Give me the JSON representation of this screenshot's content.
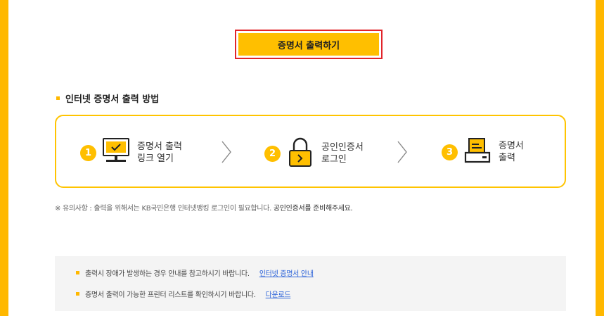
{
  "print_button": {
    "label": "증명서 출력하기"
  },
  "section": {
    "title": "인터넷 증명서 출력 방법"
  },
  "steps": [
    {
      "num": "1",
      "line1": "증명서 출력",
      "line2": "링크 열기",
      "icon": "monitor-check-icon"
    },
    {
      "num": "2",
      "line1": "공인인증서",
      "line2": "로그인",
      "icon": "padlock-icon"
    },
    {
      "num": "3",
      "line1": "증명서",
      "line2": "출력",
      "icon": "printer-icon"
    }
  ],
  "notice": {
    "prefix": "※ 유의사항 : 출력을 위해서는 KB국민은행 인터넷뱅킹 로그인이 필요합니다.",
    "highlight": "공인인증서를 준비해주세요."
  },
  "info": [
    {
      "text": "출력시 장애가 발생하는 경우 안내를 참고하시기 바랍니다.",
      "link": "인터넷 증명서 안내"
    },
    {
      "text": "증명서 출력이 가능한 프린터 리스트를 확인하시기 바랍니다.",
      "link": "다운로드"
    }
  ],
  "colors": {
    "accent": "#ffbf00",
    "border_highlight": "#e1242a",
    "link": "#2b62d9"
  }
}
